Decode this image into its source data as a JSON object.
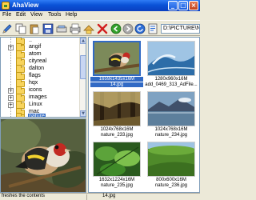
{
  "window": {
    "title": "AhaView"
  },
  "menu": [
    "File",
    "Edit",
    "View",
    "Tools",
    "Help"
  ],
  "toolbar": {
    "buttons": [
      "pencil-icon",
      "copy-icon",
      "paste-icon",
      "save-icon",
      "scan-icon",
      "print-icon",
      "move-icon",
      "delete-icon",
      "back-icon",
      "forward-icon",
      "refresh-icon",
      "properties-icon"
    ],
    "address": "D:\\PICTURE\\NATURE"
  },
  "tree": {
    "folders": [
      "..",
      "angif",
      "atom",
      "cityreal",
      "dalton",
      "flags",
      "hqx",
      "icons",
      "images",
      "Linux",
      "mac",
      "nature"
    ],
    "selected": "nature"
  },
  "thumbnails": [
    {
      "meta": "1659x1435x16M",
      "name": "14.jpg",
      "selected": true
    },
    {
      "meta": "1280x960x16M",
      "name": "add_0469_313_AdFile...",
      "selected": false
    },
    {
      "meta": "1024x768x16M",
      "name": "nature_233.jpg",
      "selected": false
    },
    {
      "meta": "1024x768x16M",
      "name": "nature_234.jpg",
      "selected": false
    },
    {
      "meta": "1632x1224x16M",
      "name": "nature_235.jpg",
      "selected": false
    },
    {
      "meta": "800x600x16M",
      "name": "nature_236.jpg",
      "selected": false
    }
  ],
  "status": {
    "text": "freshes the contents",
    "file": "14.jpg"
  }
}
